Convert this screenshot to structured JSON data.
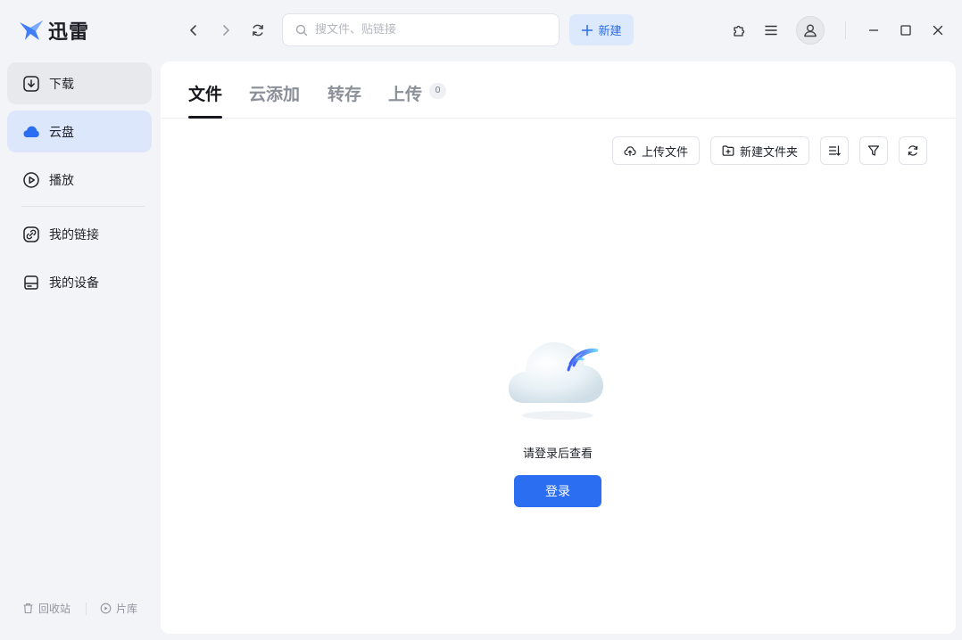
{
  "app": {
    "name": "迅雷"
  },
  "search": {
    "placeholder": "搜文件、贴链接"
  },
  "toolbar": {
    "new_label": "新建"
  },
  "sidebar": {
    "items": [
      {
        "label": "下载",
        "icon": "download-icon"
      },
      {
        "label": "云盘",
        "icon": "cloud-icon"
      },
      {
        "label": "播放",
        "icon": "play-icon"
      },
      {
        "label": "我的链接",
        "icon": "link-icon"
      },
      {
        "label": "我的设备",
        "icon": "device-icon"
      }
    ],
    "bottom": [
      {
        "label": "回收站",
        "icon": "trash-icon"
      },
      {
        "label": "片库",
        "icon": "library-icon"
      }
    ]
  },
  "tabs": [
    {
      "label": "文件"
    },
    {
      "label": "云添加"
    },
    {
      "label": "转存"
    },
    {
      "label": "上传",
      "badge": "0"
    }
  ],
  "actions": {
    "upload_file": "上传文件",
    "new_folder": "新建文件夹"
  },
  "empty": {
    "message": "请登录后查看",
    "login_label": "登录"
  },
  "colors": {
    "accent": "#2b6ef2",
    "sidebar_active": "#dce7fb",
    "new_button_bg": "#dce9fd"
  }
}
